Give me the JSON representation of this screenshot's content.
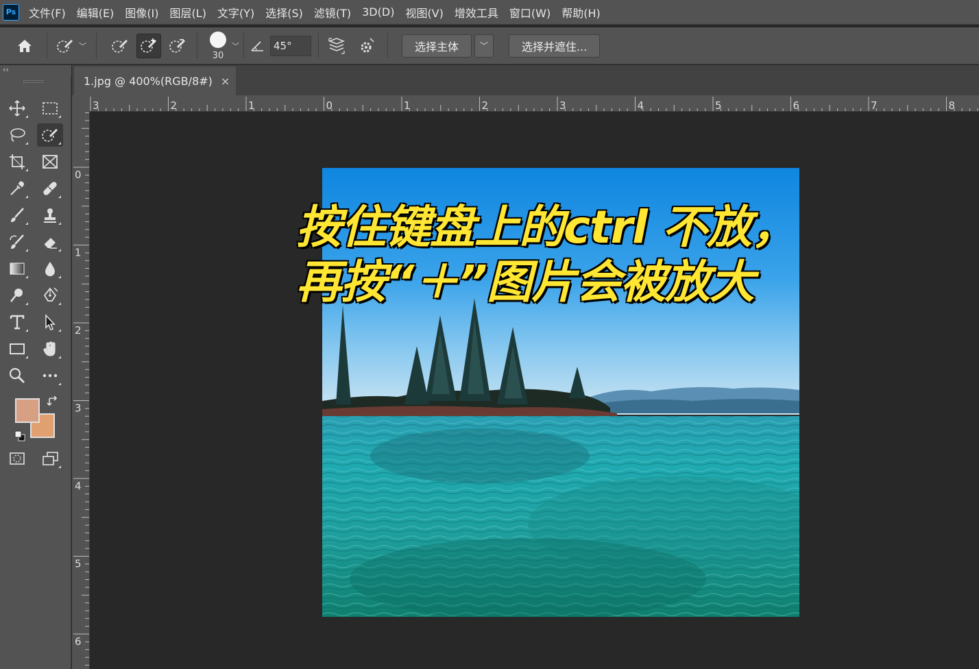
{
  "app": {
    "logo_text": "Ps"
  },
  "menu": {
    "items": [
      "文件(F)",
      "编辑(E)",
      "图像(I)",
      "图层(L)",
      "文字(Y)",
      "选择(S)",
      "滤镜(T)",
      "3D(D)",
      "视图(V)",
      "增效工具",
      "窗口(W)",
      "帮助(H)"
    ]
  },
  "options": {
    "brush_size": "30",
    "angle": "45°",
    "select_subject_label": "选择主体",
    "select_and_mask_label": "选择并遮住..."
  },
  "panel": {
    "collapse_label": "‹‹"
  },
  "colors": {
    "foreground": "#d7a084",
    "background": "#e0a070",
    "accent": "#31a8ff"
  },
  "tab": {
    "title": "1.jpg @ 400%(RGB/8#)",
    "close_label": "×"
  },
  "rulers": {
    "horizontal_labels": [
      "3",
      "2",
      "1",
      "0",
      "1",
      "2",
      "3",
      "4",
      "5",
      "6",
      "7",
      "8"
    ],
    "vertical_labels": [
      "0",
      "1",
      "2",
      "3",
      "4",
      "5",
      "6"
    ]
  },
  "caption": {
    "line1": "按住键盘上的ctrl 不放，",
    "line2": "再按“＋”图片会被放大"
  },
  "tools": [
    "move-tool",
    "marquee-tool",
    "lasso-tool",
    "quick-selection-tool",
    "crop-tool",
    "frame-tool",
    "eyedropper-tool",
    "healing-brush-tool",
    "brush-tool",
    "clone-stamp-tool",
    "history-brush-tool",
    "eraser-tool",
    "gradient-tool",
    "blur-tool",
    "dodge-tool",
    "pen-tool",
    "type-tool",
    "path-selection-tool",
    "rectangle-tool",
    "hand-tool",
    "zoom-tool",
    "more-tools",
    "quick-mask-mode",
    "screen-mode"
  ]
}
